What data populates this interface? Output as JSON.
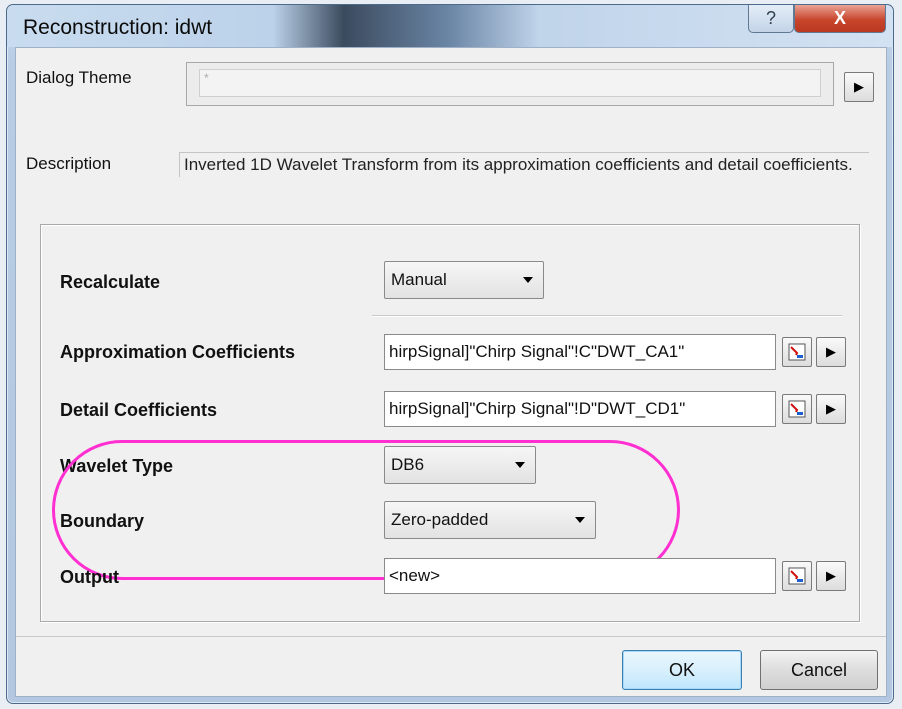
{
  "window": {
    "title": "Reconstruction: idwt",
    "help_label": "?",
    "close_label": "X"
  },
  "dialog_theme": {
    "label": "Dialog Theme",
    "value": "*",
    "arrow": "▶"
  },
  "description": {
    "label": "Description",
    "text": "Inverted 1D Wavelet Transform from its approximation coefficients and detail coefficients."
  },
  "recalculate": {
    "label": "Recalculate",
    "value": "Manual"
  },
  "approx": {
    "label": "Approximation Coefficients",
    "value": "hirpSignal]\"Chirp Signal\"!C\"DWT_CA1\"",
    "arrow": "▶"
  },
  "detail": {
    "label": "Detail Coefficients",
    "value": "hirpSignal]\"Chirp Signal\"!D\"DWT_CD1\"",
    "arrow": "▶"
  },
  "wavelet_type": {
    "label": "Wavelet Type",
    "value": "DB6"
  },
  "boundary": {
    "label": "Boundary",
    "value": "Zero-padded"
  },
  "output": {
    "label": "Output",
    "value": "<new>",
    "arrow": "▶"
  },
  "buttons": {
    "ok": "OK",
    "cancel": "Cancel"
  },
  "colors": {
    "highlight": "#ff2fd1",
    "close_button": "#c9462c"
  }
}
